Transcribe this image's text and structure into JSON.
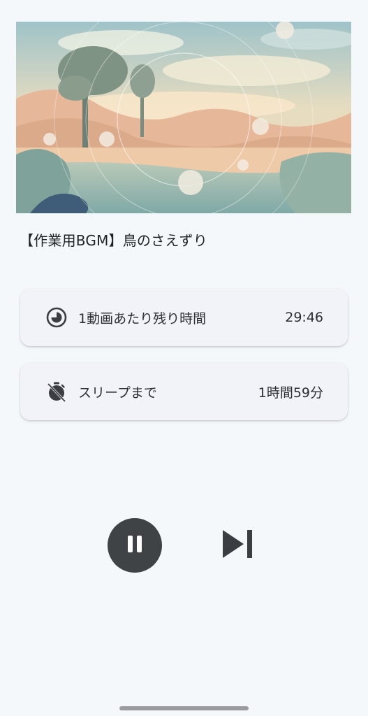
{
  "video": {
    "title": "【作業用BGM】鳥のさえずり"
  },
  "remaining_card": {
    "label": "1動画あたり残り時間",
    "value": "29:46",
    "icon": "timelapse-icon"
  },
  "sleep_card": {
    "label": "スリープまで",
    "value": "1時間59分",
    "icon": "timer-off-icon"
  },
  "controls": {
    "pause_icon": "pause-icon",
    "next_icon": "skip-next-icon"
  },
  "colors": {
    "background": "#f5f8fb",
    "card": "#f1f3f8",
    "pause_button": "#3f4346",
    "icon": "#3a3e42"
  }
}
